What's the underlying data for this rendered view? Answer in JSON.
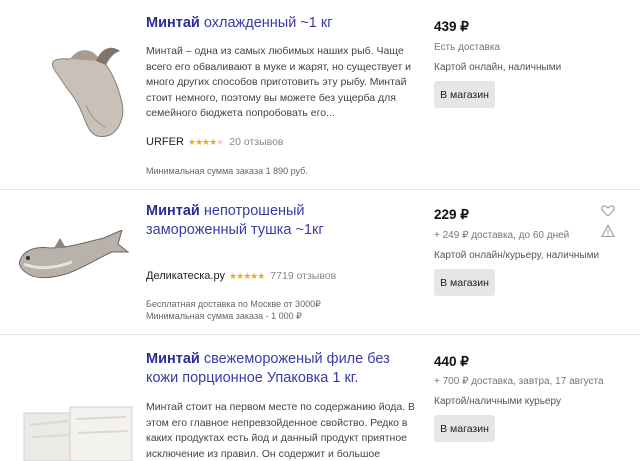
{
  "products": [
    {
      "title_highlight": "Минтай",
      "title_rest": " охлажденный ~1 кг",
      "description": "Минтай – одна из самых любимых наших рыб. Чаще всего его обваливают в муке и жарят, но существует и много других способов приготовить эту рыбу. Минтай стоит немного, поэтому вы можете без ущерба для семейного бюджета попробовать его...",
      "shop": "URFER",
      "rating_stars": 4,
      "reviews": "20 отзывов",
      "notes": [
        "Минимальная сумма заказа 1 890 руб."
      ],
      "price": "439 ₽",
      "delivery": "Есть доставка",
      "payment": "Картой онлайн, наличными",
      "button": "В магазин"
    },
    {
      "title_highlight": "Минтай",
      "title_rest": " непотрошеный замороженный тушка ~1кг",
      "shop": "Деликатеска.ру",
      "rating_stars": 5,
      "reviews": "7719 отзывов",
      "notes": [
        "Бесплатная доставка по Москве от 3000₽",
        "Минимальная сумма заказа - 1 000 ₽"
      ],
      "price": "229 ₽",
      "delivery": "+ 249 ₽ доставка, до 60 дней",
      "payment": "Картой онлайн/курьеру, наличными",
      "button": "В магазин",
      "side_icons": [
        "heart-icon",
        "warning-icon"
      ]
    },
    {
      "title_highlight": "Минтай",
      "title_rest": " свежемороженый филе без кожи порционное Упаковка 1 кг.",
      "description": "Минтай стоит на первом месте по содержанию йода. В этом его главное непревзойденное свойство. Редко в каких продуктах есть йод и данный продукт приятное исключение из правил. Он содержит и большое количество белка.",
      "price": "440 ₽",
      "delivery": "+ 700 ₽ доставка, завтра, 17 августа",
      "payment": "Картой/наличными курьеру",
      "button": "В магазин"
    }
  ],
  "colors": {
    "link": "#3b3ba8",
    "star": "#f5a623",
    "button_bg": "#e6e6e6"
  }
}
